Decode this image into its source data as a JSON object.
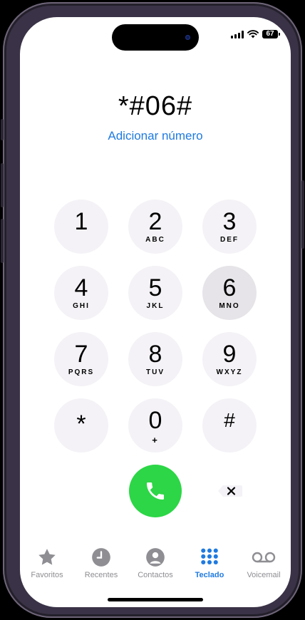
{
  "status_bar": {
    "battery": "67"
  },
  "dialer": {
    "entered_number": "*#06#",
    "add_number_link": "Adicionar número"
  },
  "keypad": [
    {
      "digit": "1",
      "letters": ""
    },
    {
      "digit": "2",
      "letters": "ABC"
    },
    {
      "digit": "3",
      "letters": "DEF"
    },
    {
      "digit": "4",
      "letters": "GHI"
    },
    {
      "digit": "5",
      "letters": "JKL"
    },
    {
      "digit": "6",
      "letters": "MNO"
    },
    {
      "digit": "7",
      "letters": "PQRS"
    },
    {
      "digit": "8",
      "letters": "TUV"
    },
    {
      "digit": "9",
      "letters": "WXYZ"
    },
    {
      "digit": "*",
      "letters": ""
    },
    {
      "digit": "0",
      "letters": "+"
    },
    {
      "digit": "#",
      "letters": ""
    }
  ],
  "actions": {
    "call_icon": "phone-icon",
    "delete_icon": "delete-icon"
  },
  "tabs": [
    {
      "label": "Favoritos",
      "icon": "star-icon"
    },
    {
      "label": "Recentes",
      "icon": "clock-icon"
    },
    {
      "label": "Contactos",
      "icon": "person-icon"
    },
    {
      "label": "Teclado",
      "icon": "keypad-icon",
      "active": true
    },
    {
      "label": "Voicemail",
      "icon": "voicemail-icon"
    }
  ],
  "colors": {
    "accent": "#1f7ae0",
    "call_green": "#2cd646",
    "key_background": "#f4f2f6",
    "inactive_tab": "#8e8e93"
  }
}
